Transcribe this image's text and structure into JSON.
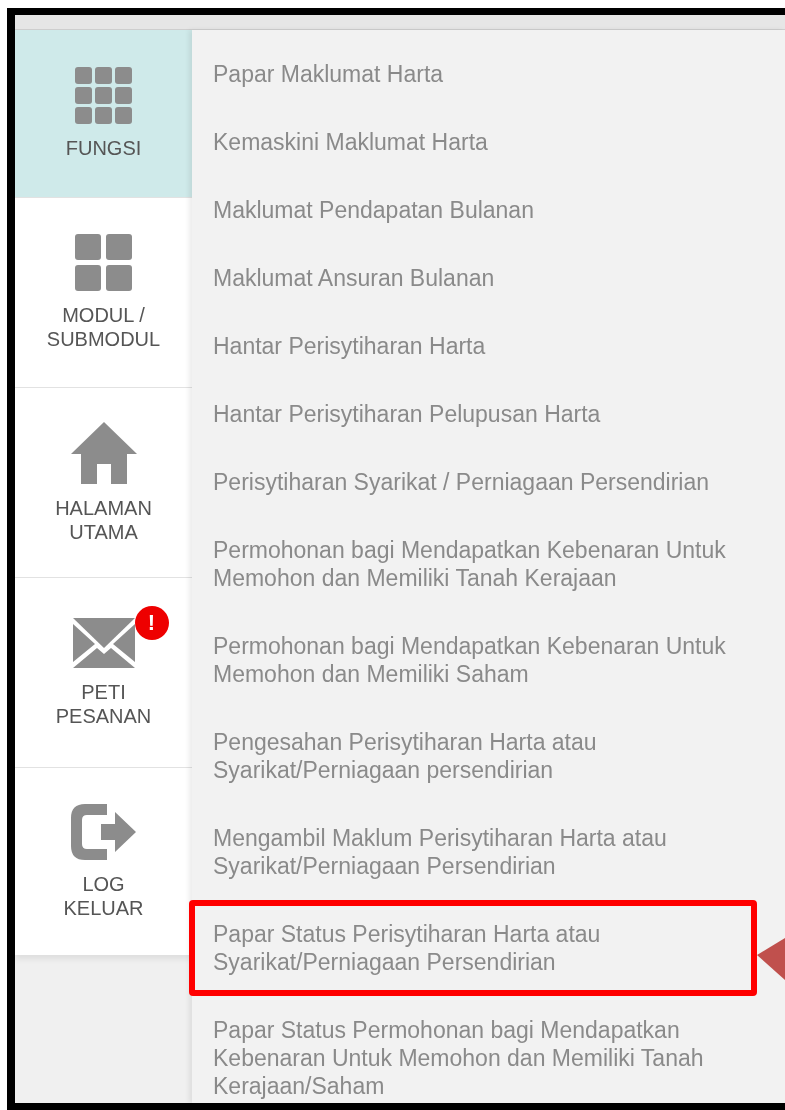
{
  "sidebar": {
    "items": [
      {
        "kind": "grid",
        "label": "FUNGSI",
        "selected": true
      },
      {
        "kind": "modules",
        "label": "MODUL / SUBMODUL",
        "selected": false
      },
      {
        "kind": "home",
        "label": "HALAMAN UTAMA",
        "selected": false
      },
      {
        "kind": "mail",
        "label": "PETI PESANAN",
        "selected": false,
        "badge": "!"
      },
      {
        "kind": "logout",
        "label": "LOG KELUAR",
        "selected": false
      }
    ]
  },
  "menu": {
    "items": [
      {
        "label": "Papar Maklumat Harta",
        "highlighted": false
      },
      {
        "label": "Kemaskini Maklumat Harta",
        "highlighted": false
      },
      {
        "label": "Maklumat Pendapatan Bulanan",
        "highlighted": false
      },
      {
        "label": "Maklumat Ansuran Bulanan",
        "highlighted": false
      },
      {
        "label": "Hantar Perisytiharan Harta",
        "highlighted": false
      },
      {
        "label": "Hantar Perisytiharan Pelupusan Harta",
        "highlighted": false
      },
      {
        "label": "Perisytiharan Syarikat / Perniagaan Persendirian",
        "highlighted": false
      },
      {
        "label": "Permohonan bagi Mendapatkan Kebenaran Untuk Memohon dan Memiliki Tanah Kerajaan",
        "highlighted": false
      },
      {
        "label": "Permohonan bagi Mendapatkan Kebenaran Untuk Memohon dan Memiliki Saham",
        "highlighted": false
      },
      {
        "label": "Pengesahan Perisytiharan Harta atau Syarikat/Perniagaan persendirian",
        "highlighted": false
      },
      {
        "label": "Mengambil Maklum Perisytiharan Harta atau Syarikat/Perniagaan Persendirian",
        "highlighted": false
      },
      {
        "label": "Papar Status Perisytiharan Harta atau Syarikat/Perniagaan Persendirian",
        "highlighted": true
      },
      {
        "label": "Papar Status Permohonan bagi Mendapatkan Kebenaran Untuk Memohon dan Memiliki Tanah Kerajaan/Saham",
        "highlighted": false
      }
    ]
  }
}
